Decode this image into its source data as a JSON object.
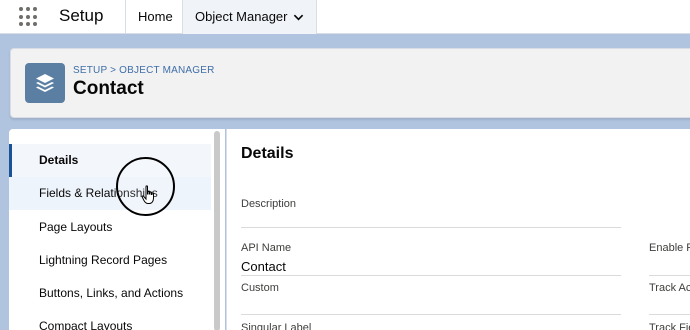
{
  "topnav": {
    "app_title": "Setup",
    "tabs": [
      {
        "label": "Home"
      },
      {
        "label": "Object Manager"
      }
    ]
  },
  "header": {
    "breadcrumb": "SETUP > OBJECT MANAGER",
    "title": "Contact",
    "icon": "layers-icon"
  },
  "sidebar": {
    "items": [
      {
        "label": "Details",
        "active": true
      },
      {
        "label": "Fields & Relationships"
      },
      {
        "label": "Page Layouts"
      },
      {
        "label": "Lightning Record Pages"
      },
      {
        "label": "Buttons, Links, and Actions"
      },
      {
        "label": "Compact Layouts"
      }
    ]
  },
  "main": {
    "title": "Details",
    "fields": {
      "description": {
        "label": "Description",
        "value": ""
      },
      "api_name": {
        "label": "API Name",
        "value": "Contact"
      },
      "custom": {
        "label": "Custom",
        "value": ""
      },
      "singular_label": {
        "label": "Singular Label",
        "value": ""
      }
    },
    "right_fields": {
      "enable_reports": {
        "label": "Enable R"
      },
      "track_activities": {
        "label": "Track Ac"
      },
      "track_field_history": {
        "label": "Track Fie"
      }
    }
  },
  "colors": {
    "accent": "#1b5297",
    "icon_bg": "#5b7fa3",
    "page_bg": "#b0c4df"
  }
}
